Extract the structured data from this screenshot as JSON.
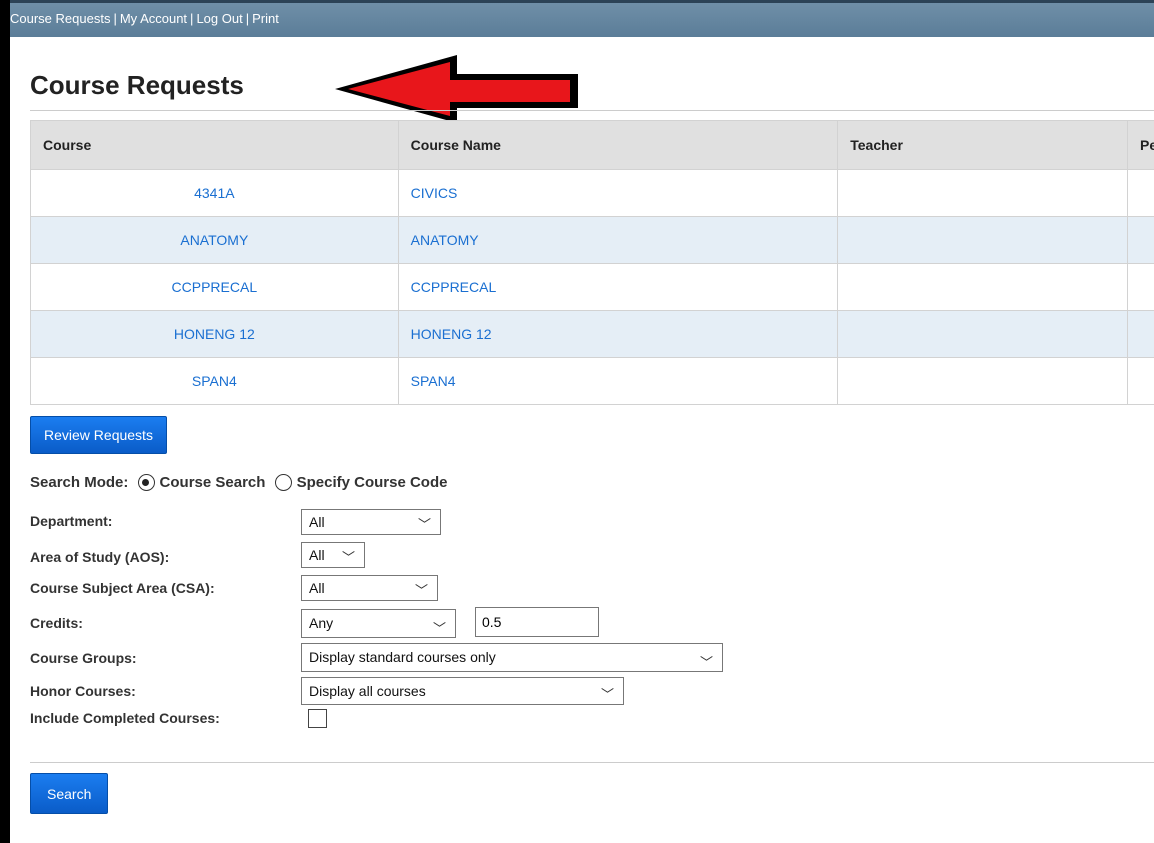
{
  "nav": {
    "links": [
      "Course Requests",
      "My Account",
      "Log Out",
      "Print"
    ]
  },
  "page": {
    "title": "Course Requests"
  },
  "table": {
    "headers": [
      "Course",
      "Course Name",
      "Teacher",
      "Pe"
    ],
    "rows": [
      {
        "course": "4341A",
        "name": "CIVICS"
      },
      {
        "course": "ANATOMY",
        "name": "ANATOMY"
      },
      {
        "course": "CCPPRECAL",
        "name": "CCPPRECAL"
      },
      {
        "course": "HONENG 12",
        "name": "HONENG 12"
      },
      {
        "course": "SPAN4",
        "name": "SPAN4"
      }
    ]
  },
  "buttons": {
    "review": "Review Requests",
    "search": "Search"
  },
  "search_mode": {
    "label": "Search Mode:",
    "options": [
      "Course Search",
      "Specify Course Code"
    ],
    "selected": "Course Search"
  },
  "form": {
    "department": {
      "label": "Department:",
      "value": "All"
    },
    "aos": {
      "label": "Area of Study (AOS):",
      "value": "All"
    },
    "csa": {
      "label": "Course Subject Area (CSA):",
      "value": "All"
    },
    "credits": {
      "label": "Credits:",
      "value": "Any",
      "amount": "0.5"
    },
    "groups": {
      "label": "Course Groups:",
      "value": "Display standard courses only"
    },
    "honor": {
      "label": "Honor Courses:",
      "value": "Display all courses"
    },
    "completed": {
      "label": "Include Completed Courses:",
      "checked": false
    }
  },
  "colors": {
    "accent": "#1a6fd1",
    "topbar": "#6f8fa8",
    "button": "#0a5cc8",
    "arrow": "#e8161b"
  }
}
